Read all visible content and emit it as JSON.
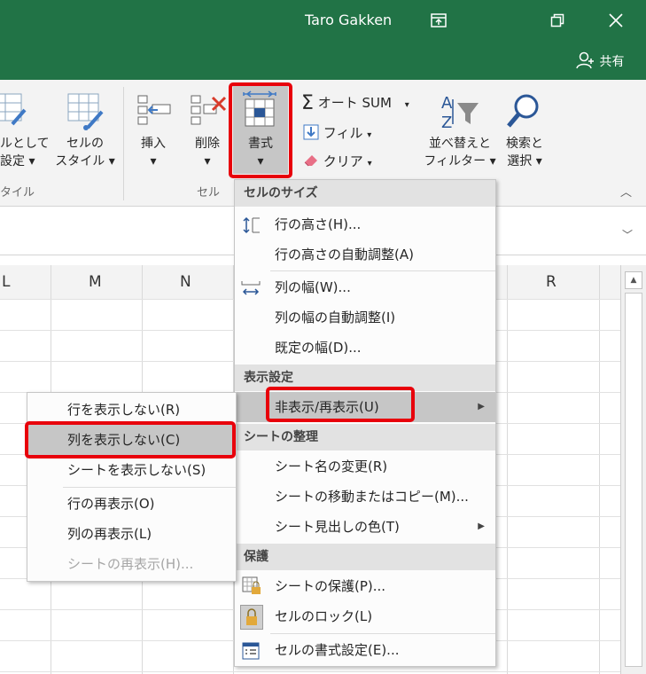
{
  "titlebar": {
    "user": "Taro Gakken",
    "share": "共有",
    "bg_color": "#217346"
  },
  "ribbon": {
    "style_group": {
      "table_format_line1": "ルとして",
      "table_format_line2": "設定",
      "cell_style_line1": "セルの",
      "cell_style_line2": "スタイル",
      "group_label": "タイル"
    },
    "cells_group": {
      "insert": "挿入",
      "delete": "削除",
      "format": "書式",
      "group_label": "セル"
    },
    "edit_group": {
      "autosum": "オート SUM",
      "fill": "フィル",
      "clear": "クリア",
      "sort_line1": "並べ替えと",
      "sort_line2": "フィルター",
      "find_line1": "検索と",
      "find_line2": "選択"
    }
  },
  "grid": {
    "columns": [
      "L",
      "M",
      "N",
      "R"
    ]
  },
  "format_menu": {
    "cell_size_header": "セルのサイズ",
    "row_height": "行の高さ(H)...",
    "row_autofit": "行の高さの自動調整(A)",
    "col_width": "列の幅(W)...",
    "col_autofit": "列の幅の自動調整(I)",
    "default_width": "既定の幅(D)...",
    "visibility_header": "表示設定",
    "hide_unhide": "非表示/再表示(U)",
    "organize_header": "シートの整理",
    "rename_sheet": "シート名の変更(R)",
    "move_copy_sheet": "シートの移動またはコピー(M)...",
    "tab_color": "シート見出しの色(T)",
    "protection_header": "保護",
    "protect_sheet": "シートの保護(P)...",
    "lock_cell": "セルのロック(L)",
    "format_cells": "セルの書式設定(E)..."
  },
  "hide_submenu": {
    "hide_rows": "行を表示しない(R)",
    "hide_columns": "列を表示しない(C)",
    "hide_sheet": "シートを表示しない(S)",
    "unhide_rows": "行の再表示(O)",
    "unhide_columns": "列の再表示(L)",
    "unhide_sheet": "シートの再表示(H)..."
  },
  "highlight_color": "#e8000b"
}
